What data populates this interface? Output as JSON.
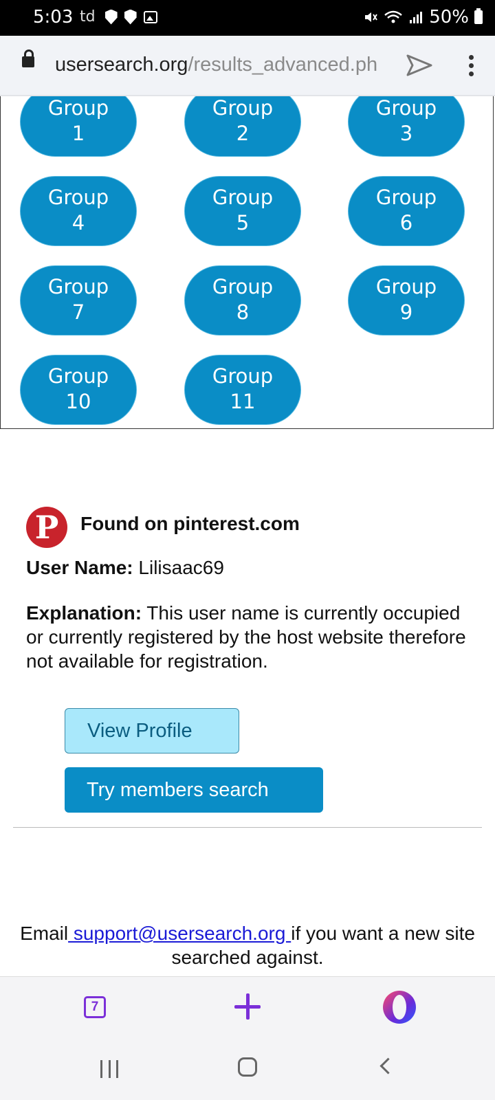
{
  "status_bar": {
    "time": "5:03",
    "carrier": "td",
    "battery": "50%"
  },
  "browser": {
    "url_host": "usersearch.org",
    "url_path": "/results_advanced.ph",
    "tab_count": "7"
  },
  "groups": [
    {
      "word": "Group",
      "num": "1"
    },
    {
      "word": "Group",
      "num": "2"
    },
    {
      "word": "Group",
      "num": "3"
    },
    {
      "word": "Group",
      "num": "4"
    },
    {
      "word": "Group",
      "num": "5"
    },
    {
      "word": "Group",
      "num": "6"
    },
    {
      "word": "Group",
      "num": "7"
    },
    {
      "word": "Group",
      "num": "8"
    },
    {
      "word": "Group",
      "num": "9"
    },
    {
      "word": "Group",
      "num": "10"
    },
    {
      "word": "Group",
      "num": "11"
    }
  ],
  "result": {
    "logo_letter": "P",
    "found_label": "Found on pinterest.com",
    "username_label": "User Name:",
    "username_value": "Lilisaac69",
    "explanation_label": "Explanation:",
    "explanation_text": "This user name is currently occupied or currently registered by the host website therefore not available for registration.",
    "view_profile_label": "View Profile",
    "members_search_label": "Try members search"
  },
  "footer": {
    "prefix": "Email",
    "email_link": " support@usersearch.org ",
    "suffix": "if you want a new site searched against."
  },
  "colors": {
    "accent": "#0a8dc6",
    "view_profile_bg": "#a9e8fb",
    "pinterest_red": "#c8232c",
    "browser_purple": "#7b2fd8"
  }
}
